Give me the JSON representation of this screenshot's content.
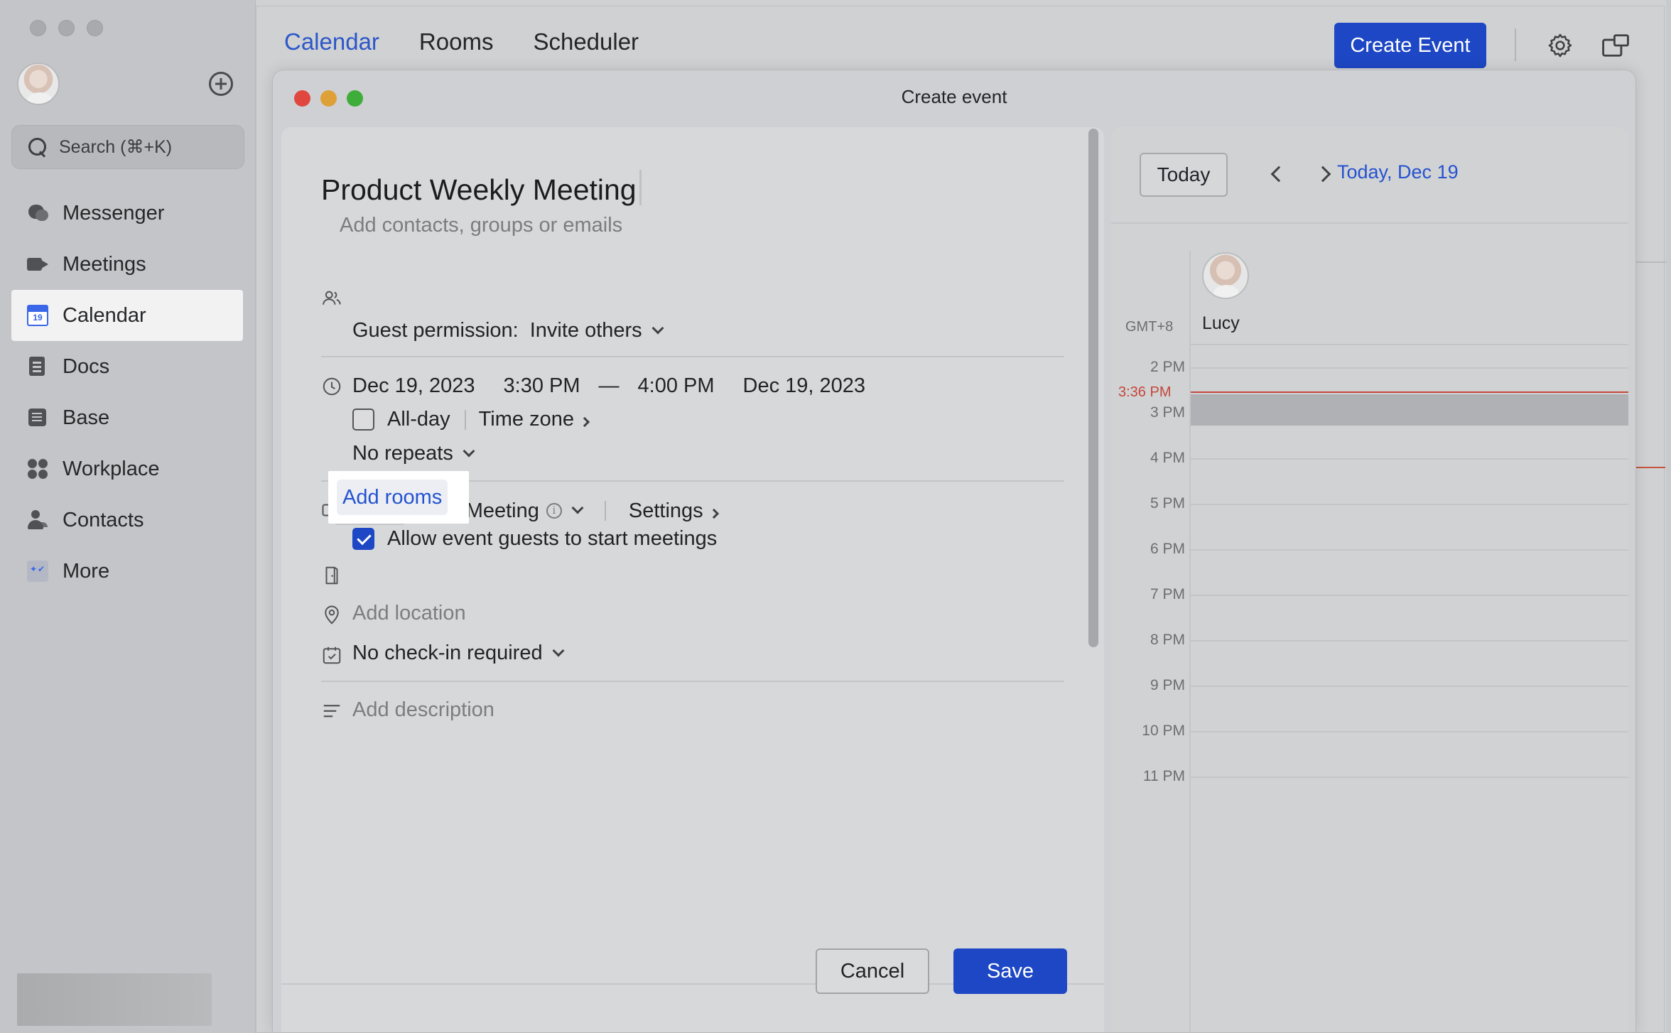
{
  "sidebar": {
    "search_placeholder": "Search (⌘+K)",
    "items": [
      {
        "label": "Messenger",
        "icon": "messenger-icon"
      },
      {
        "label": "Meetings",
        "icon": "meetings-icon"
      },
      {
        "label": "Calendar",
        "icon": "calendar-icon",
        "active": true
      },
      {
        "label": "Docs",
        "icon": "docs-icon"
      },
      {
        "label": "Base",
        "icon": "base-icon"
      },
      {
        "label": "Workplace",
        "icon": "workplace-icon"
      },
      {
        "label": "Contacts",
        "icon": "contacts-icon"
      },
      {
        "label": "More",
        "icon": "more-icon"
      }
    ]
  },
  "topbar": {
    "tabs": [
      {
        "label": "Calendar",
        "active": true
      },
      {
        "label": "Rooms"
      },
      {
        "label": "Scheduler"
      }
    ],
    "create_label": "Create Event"
  },
  "modal": {
    "title": "Create event",
    "event_title": "Product Weekly Meeting",
    "guests_placeholder": "Add contacts, groups or emails",
    "guest_permission_label": "Guest permission:",
    "guest_permission_value": "Invite others",
    "start_date": "Dec 19, 2023",
    "start_time": "3:30 PM",
    "dash": "—",
    "end_time": "4:00 PM",
    "end_date": "Dec 19, 2023",
    "allday_label": "All-day",
    "timezone_label": "Time zone",
    "repeat_label": "No repeats",
    "video_label": "Video Meeting",
    "settings_label": "Settings",
    "allow_guests_label": "Allow event guests to start meetings",
    "add_rooms_label": "Add rooms",
    "location_placeholder": "Add location",
    "checkin_label": "No check-in required",
    "description_placeholder": "Add description",
    "cancel_label": "Cancel",
    "save_label": "Save"
  },
  "calendar": {
    "today_label": "Today",
    "date_label": "Today, Dec 19",
    "timezone": "GMT+8",
    "attendee": "Lucy",
    "now_label": "3:36 PM",
    "hours": [
      "2 PM",
      "3 PM",
      "4 PM",
      "5 PM",
      "6 PM",
      "7 PM",
      "8 PM",
      "9 PM",
      "10 PM",
      "11 PM"
    ]
  },
  "colors": {
    "accent": "#1d47c4",
    "link": "#2453d0",
    "now_line": "#c4473a"
  }
}
